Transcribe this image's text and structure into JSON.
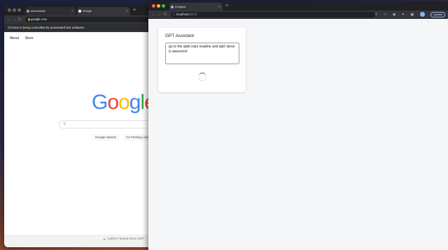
{
  "left_browser": {
    "tabs": [
      {
        "title": "about:blank",
        "icon": "globe-icon"
      },
      {
        "title": "Google",
        "icon": "google-icon"
      }
    ],
    "address": "google.com",
    "infobar_text": "Chrome is being controlled by automated test software.",
    "page": {
      "nav": [
        "About",
        "Store"
      ],
      "logo": "Google",
      "search_button": "Google Search",
      "lucky_button": "I'm Feeling Lucky",
      "footer": "Carbon neutral since 2007"
    }
  },
  "right_browser": {
    "tab_title": "AI Agent",
    "address_host": "localhost",
    "address_port": ":3173",
    "update_label": "Update",
    "app": {
      "title": "GPT Assistant",
      "prompt_value": "go to the qwik repo readme and add 'steve is awesome'"
    }
  },
  "colors": {
    "google_blue": "#4285F4",
    "google_red": "#EA4335",
    "google_yellow": "#FBBC05",
    "google_green": "#34A853"
  }
}
